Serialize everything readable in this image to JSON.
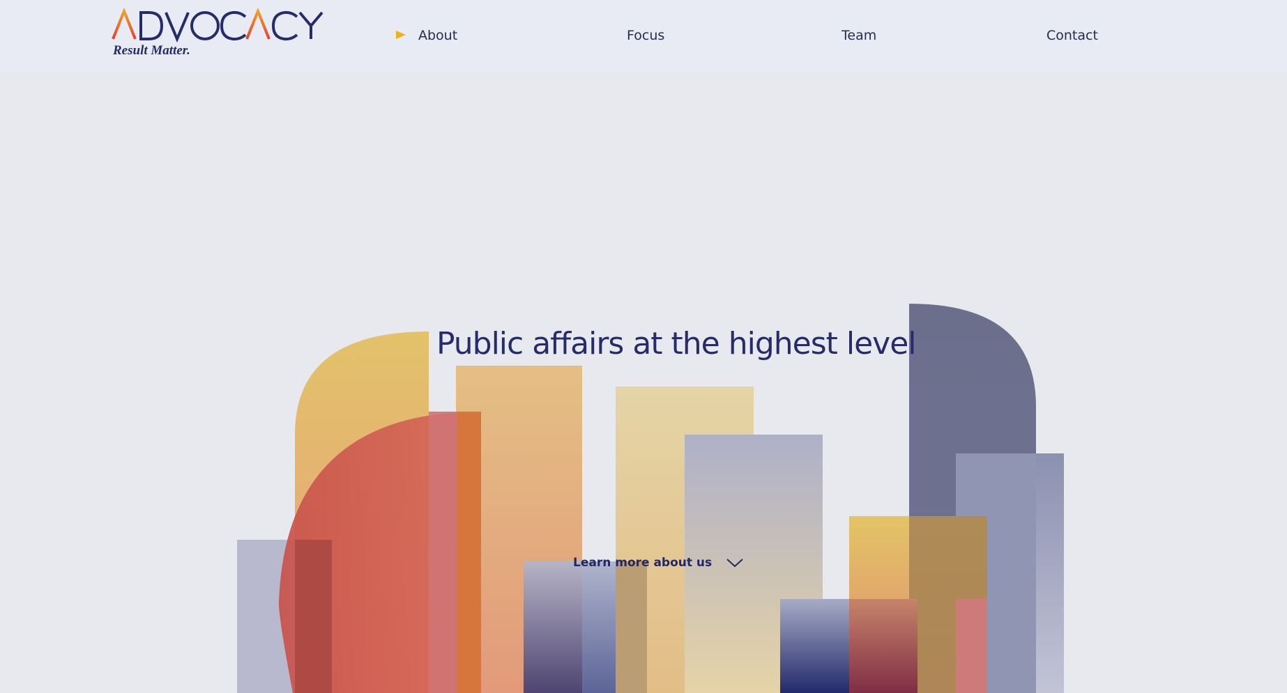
{
  "brand": {
    "logo_text": "ADVOCACY",
    "tagline": "Result Matter."
  },
  "nav": {
    "items": [
      {
        "label": "About",
        "active": true
      },
      {
        "label": "Focus",
        "active": false
      },
      {
        "label": "Team",
        "active": false
      },
      {
        "label": "Contact",
        "active": false
      }
    ]
  },
  "hero": {
    "title": "Public affairs at the highest level",
    "cta_label": "Learn more about us",
    "cta_icon": "chevron-down-icon"
  },
  "colors": {
    "navy": "#262b6a",
    "accent_orange": "#e45a2c",
    "accent_yellow": "#eeb01b",
    "header_bg": "#e8ebf4",
    "page_bg": "#e8e9ee"
  }
}
